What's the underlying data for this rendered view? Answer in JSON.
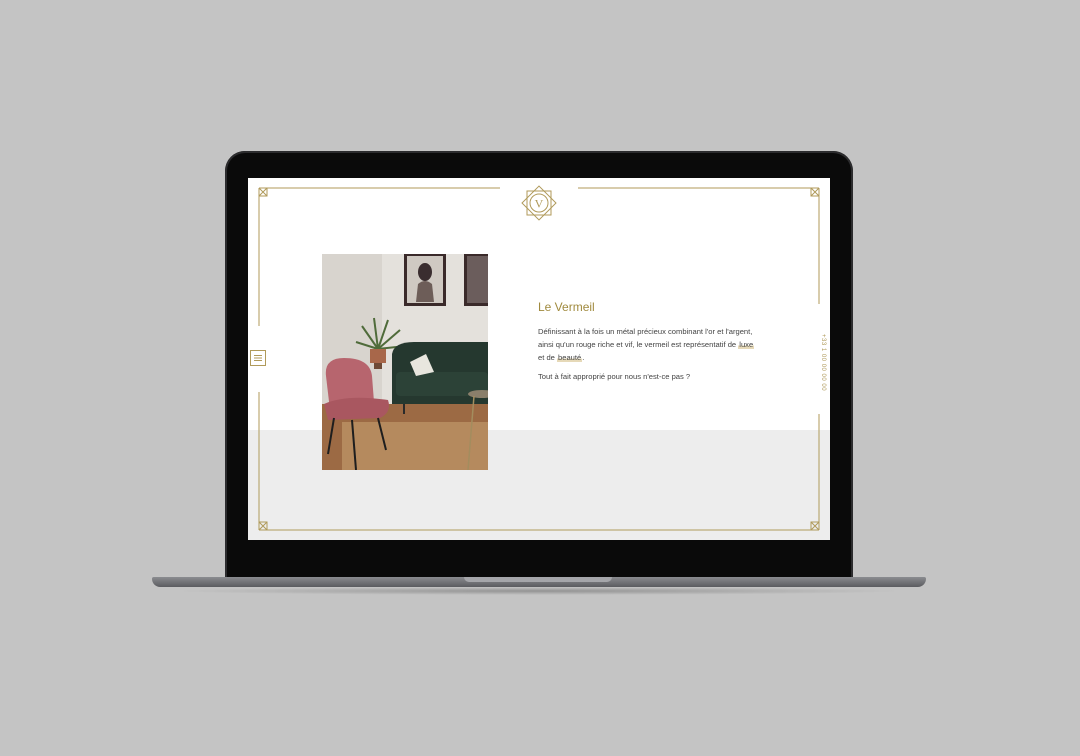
{
  "site": {
    "logo_letter": "V",
    "menu_icon": "hamburger-menu-icon",
    "phone_text": "+33 1 00 00 00 00"
  },
  "article": {
    "title": "Le Vermeil",
    "para1_part1": "Définissant à la fois un métal précieux combinant l'or et l'argent, ainsi qu'un rouge riche et vif, le vermeil est représentatif de ",
    "para1_link1": "luxe",
    "para1_part2": " et de ",
    "para1_link2": "beauté",
    "para1_part3": ".",
    "para2": "Tout à fait approprié pour nous n'est-ce pas ?"
  },
  "colors": {
    "gold": "#b09a5a",
    "title_gold": "#a08a3e",
    "background": "#c4c4c4",
    "screen_band": "#ededed"
  }
}
